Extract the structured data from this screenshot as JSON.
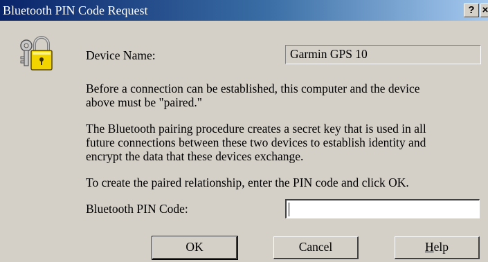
{
  "window": {
    "title": "Bluetooth PIN Code Request",
    "help_glyph": "?",
    "close_glyph": "×"
  },
  "device": {
    "label": "Device Name:",
    "value": "Garmin GPS 10"
  },
  "paragraphs": {
    "p1_line1": "Before a connection can be established, this computer and the device",
    "p1_line2": "above must be \"paired.\"",
    "p2_line1": "The Bluetooth pairing procedure creates a secret key that is used in all",
    "p2_line2": "future connections between these two devices to establish identity and",
    "p2_line3": "encrypt the data that these devices exchange.",
    "p3_line1": "To create the paired relationship, enter the PIN code and click OK."
  },
  "pin": {
    "label": "Bluetooth PIN Code:",
    "value": ""
  },
  "buttons": {
    "ok": "OK",
    "cancel": "Cancel",
    "help": "Help"
  },
  "icons": {
    "dialog_icon": "key-lock-icon"
  },
  "colors": {
    "titlebar_start": "#0a246a",
    "titlebar_end": "#a6caf0",
    "dialog_face": "#d4d0c8"
  }
}
